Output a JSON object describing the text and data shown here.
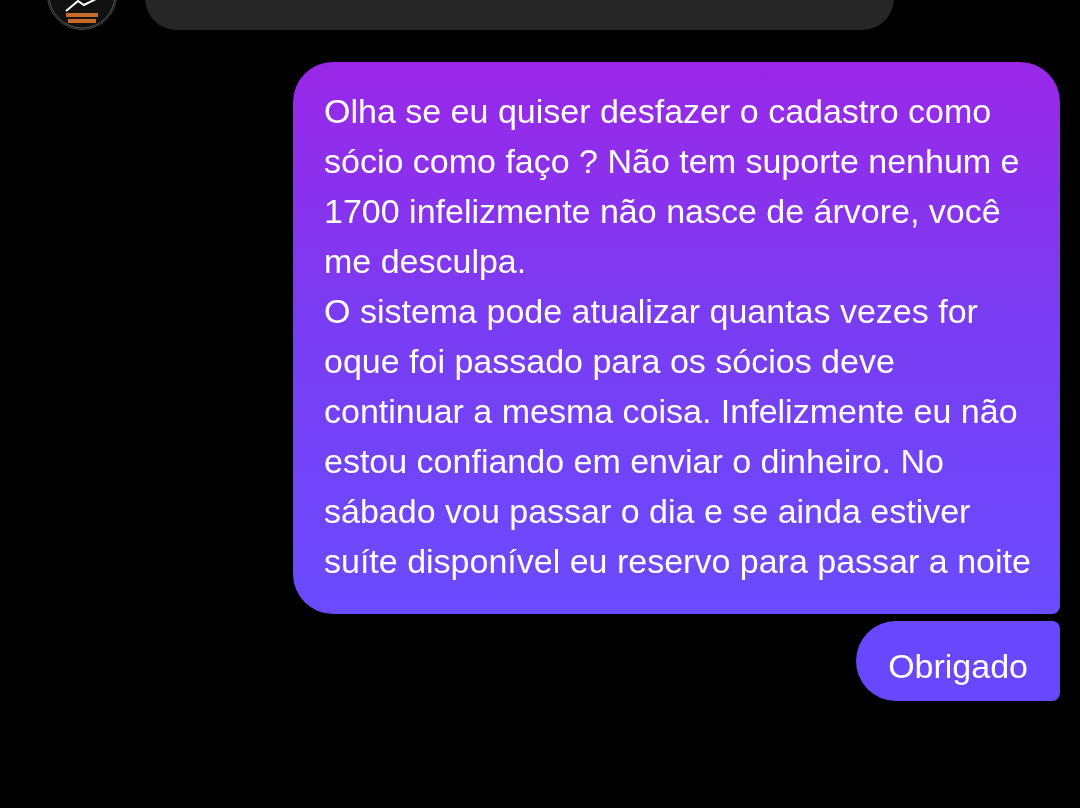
{
  "messages": [
    {
      "kind": "received"
    },
    {
      "kind": "sent",
      "text": "Olha se eu quiser desfazer o cadastro como sócio como faço ? Não tem suporte nenhum e 1700 infelizmente não nasce de árvore, você me desculpa.\nO sistema pode atualizar quantas vezes for oque foi passado para os sócios deve continuar a mesma coisa. Infelizmente eu não estou confiando em enviar o dinheiro. No sábado vou passar o dia e se ainda estiver suíte disponível eu reservo para passar a noite"
    },
    {
      "kind": "sent",
      "text": "Obrigado"
    }
  ]
}
